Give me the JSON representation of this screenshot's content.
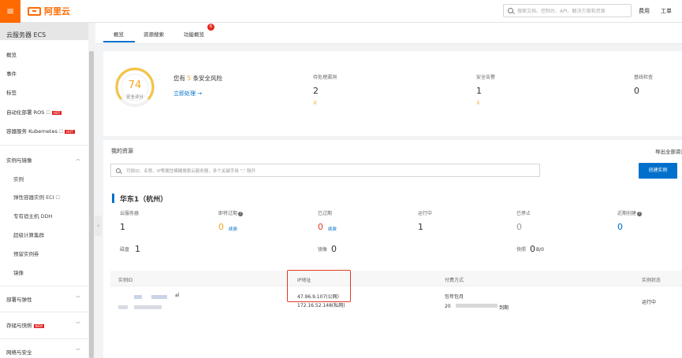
{
  "topbar": {
    "menu_icon": "menu-icon",
    "brand_name": "阿里云",
    "search_placeholder": "搜索文档、控制台、API、解决方案和资源",
    "links": [
      "费用",
      "工单"
    ]
  },
  "sidebar": {
    "title": "云服务器 ECS",
    "items": [
      {
        "label": "概览"
      },
      {
        "label": "事件"
      },
      {
        "label": "标签"
      },
      {
        "label": "自动化部署 ROS",
        "ext": "☐",
        "tag": "HOT"
      },
      {
        "label": "容器服务 Kubernetes",
        "ext": "☐",
        "tag": "HOT"
      }
    ],
    "groups": [
      {
        "label": "实例与镜像",
        "chevron": "︿",
        "children": [
          "实例",
          "弹性容器实例 ECI",
          "专有宿主机 DDH",
          "超级计算集群",
          "预留实例券",
          "镜像"
        ]
      },
      {
        "label": "部署与弹性",
        "chevron": "﹀"
      },
      {
        "label": "存储与快照",
        "chevron": "﹀",
        "tag": "NEW"
      },
      {
        "label": "网络与安全",
        "chevron": "﹀"
      }
    ],
    "eci_ext": "☐"
  },
  "tabs": [
    {
      "label": "概览"
    },
    {
      "label": "资源搜索"
    },
    {
      "label": "功能概览",
      "badge": "6"
    }
  ],
  "security": {
    "score": "74",
    "score_label": "安全评分",
    "risk_prefix": "您有",
    "risk_count": "5",
    "risk_suffix": "条安全风险",
    "action": "立即处理 →",
    "stats": [
      {
        "label": "待处理漏洞",
        "value": "2",
        "sub": "2"
      },
      {
        "label": "安全告警",
        "value": "1",
        "sub": "1"
      },
      {
        "label": "基线检查",
        "value": "0"
      }
    ]
  },
  "resources": {
    "title": "我的资源",
    "export": "导出全部资源",
    "search_placeholder": "可按ID、名称、IP等属性模糊搜索云服务器，多个关键字用 \",\" 隔开",
    "create_button": "创建实例",
    "region": "华东1（杭州）",
    "row1": [
      {
        "label": "云服务器",
        "value": "1"
      },
      {
        "label": "即将过期",
        "value": "0",
        "link": "续费"
      },
      {
        "label": "已过期",
        "value": "0",
        "link": "续费"
      },
      {
        "label": "运行中",
        "value": "1"
      },
      {
        "label": "已停止",
        "value": "0"
      },
      {
        "label": "近期创建",
        "value": "0"
      }
    ],
    "row2": [
      {
        "label": "磁盘",
        "value": "1"
      },
      {
        "label": "镜像",
        "value": "0"
      },
      {
        "label": "快照",
        "value": "0",
        "suffix": "B/0"
      }
    ],
    "table": {
      "headers": [
        "实例ID",
        "IP地址",
        "付费方式",
        "实例状态"
      ],
      "rows": [
        {
          "id_suffix": "al",
          "ip_public": "47.96.9.107(公网)",
          "ip_private": "172.16.52.148(私网)",
          "pay": "包年包月",
          "expire_prefix": "20",
          "expire_suffix": "到期",
          "status": "运行中"
        }
      ]
    }
  }
}
